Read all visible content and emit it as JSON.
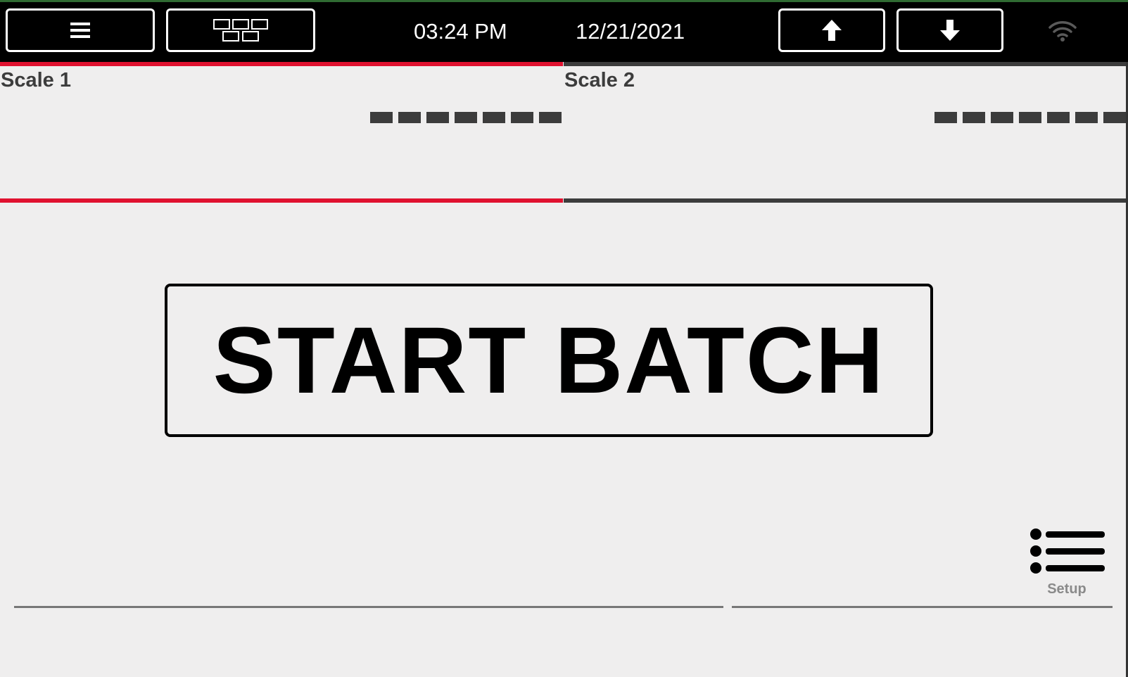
{
  "header": {
    "time": "03:24 PM",
    "date": "12/21/2021",
    "menu_icon": "hamburger-icon",
    "layout_icon": "scale-layout-icon",
    "up_icon": "arrow-up-icon",
    "down_icon": "arrow-down-icon",
    "wifi_icon": "wifi-icon"
  },
  "scales": [
    {
      "title": "Scale 1",
      "reading": "--------",
      "active": true,
      "accent": "#e0112f"
    },
    {
      "title": "Scale 2",
      "reading": "--------",
      "active": false,
      "accent": "#3c3c3c"
    }
  ],
  "main": {
    "start_label": "START BATCH"
  },
  "setup": {
    "label": "Setup",
    "icon": "list-icon"
  },
  "colors": {
    "accent_red": "#e0112f",
    "topbar": "#000000",
    "background": "#efeeee",
    "panel_text": "#3c3c3c"
  }
}
